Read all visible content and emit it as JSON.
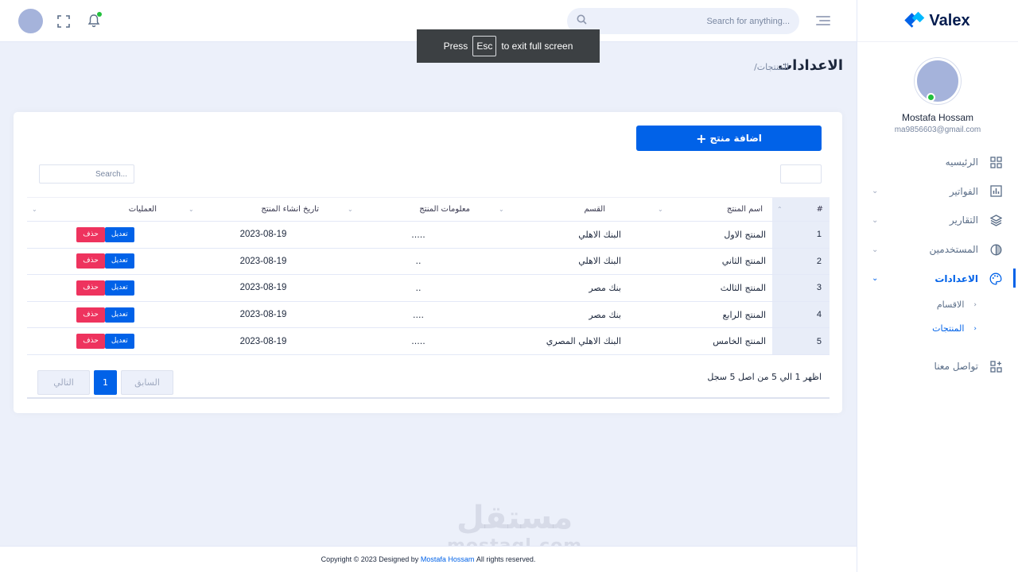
{
  "app": {
    "logo_text": "Valex"
  },
  "topbar": {
    "search_placeholder": "Search for anything..."
  },
  "toast": {
    "press": "Press",
    "key": "Esc",
    "rest": "to exit full screen"
  },
  "profile": {
    "name": "Mostafa Hossam",
    "email": "ma9856603@gmail.com"
  },
  "sidebar": {
    "items": [
      {
        "label": "الرئيسيه",
        "icon": "dashboard-icon"
      },
      {
        "label": "الفواتير",
        "icon": "chart-icon"
      },
      {
        "label": "التقارير",
        "icon": "layers-icon"
      },
      {
        "label": "المستخدمين",
        "icon": "globe-icon"
      },
      {
        "label": "الاعدادات",
        "icon": "palette-icon"
      }
    ],
    "subitems": [
      {
        "label": "الاقسام"
      },
      {
        "label": "المنتجات"
      }
    ],
    "contact": {
      "label": "تواصل معنا",
      "icon": "grid-plus-icon"
    }
  },
  "page": {
    "title": "الاعدادات",
    "breadcrumb": "/المنتجات"
  },
  "card": {
    "add_button": "اضافة منتج",
    "search_placeholder": "Search...",
    "columns": [
      "#",
      "اسم المنتج",
      "القسم",
      "معلومات المنتج",
      "تاريخ انشاء المنتج",
      "العمليات"
    ],
    "rows": [
      {
        "num": "1",
        "name": "المنتج الاول",
        "section": "البنك الاهلي",
        "info": ".....",
        "date": "2023-08-19"
      },
      {
        "num": "2",
        "name": "المنتج الثاني",
        "section": "البنك الاهلي",
        "info": "..",
        "date": "2023-08-19"
      },
      {
        "num": "3",
        "name": "المنتج الثالث",
        "section": "بنك مصر",
        "info": "..",
        "date": "2023-08-19"
      },
      {
        "num": "4",
        "name": "المنتج الرابع",
        "section": "بنك مصر",
        "info": "....",
        "date": "2023-08-19"
      },
      {
        "num": "5",
        "name": "المنتج الخامس",
        "section": "البنك الاهلي المصري",
        "info": ".....",
        "date": "2023-08-19"
      }
    ],
    "edit_label": "تعديل",
    "delete_label": "حذف",
    "info_text": "اظهر 1 الي 5 من اصل 5 سجل",
    "pager": {
      "prev": "السابق",
      "current": "1",
      "next": "التالي"
    }
  },
  "footer": {
    "prefix": "Copyright © 2023 Designed by",
    "brand": "Mostafa Hossam",
    "suffix": "All rights reserved."
  },
  "watermark": {
    "arabic": "مستقل",
    "latin": "mostaql.com"
  },
  "colors": {
    "primary": "#0162e8",
    "danger": "#ee335e",
    "online": "#22c03c"
  }
}
